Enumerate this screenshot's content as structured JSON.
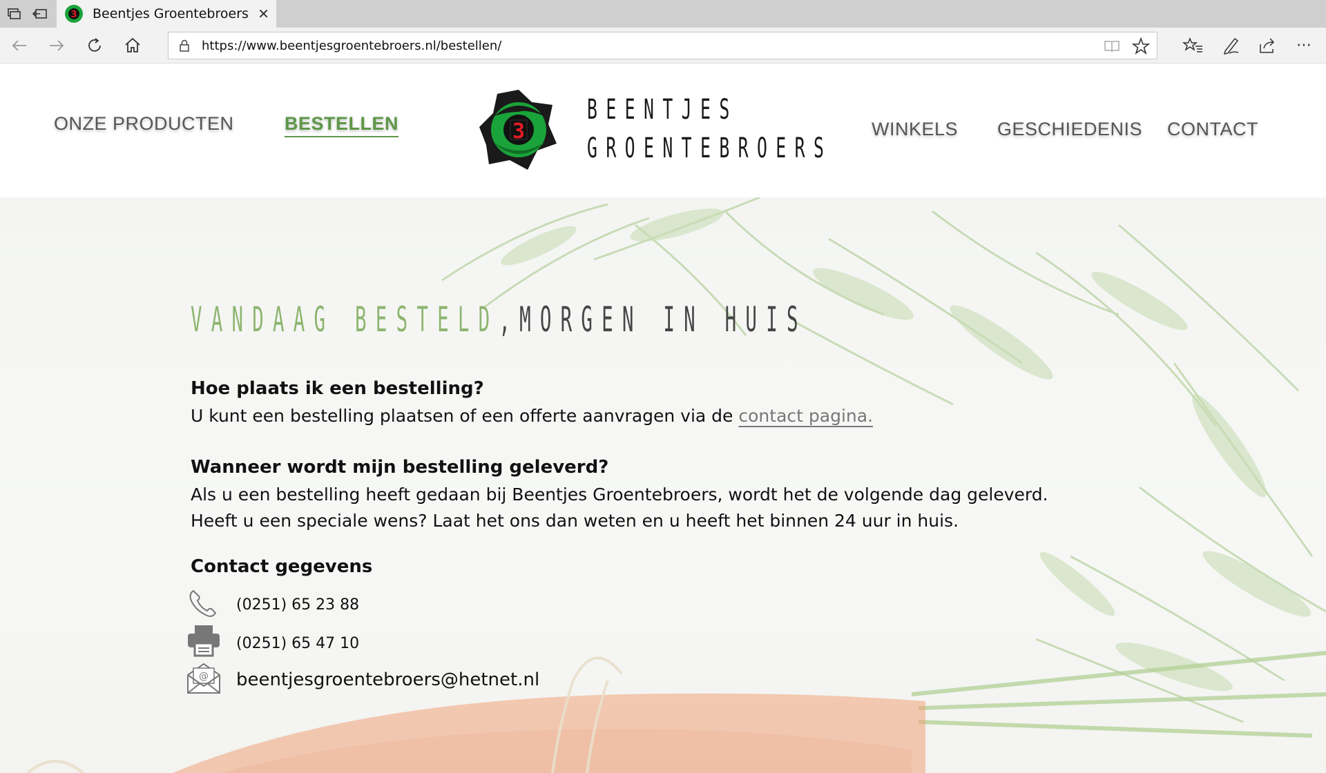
{
  "browser": {
    "tab_title": "Beentjes Groentebroers",
    "url": "https://www.beentjesgroentebroers.nl/bestellen/"
  },
  "icons": {
    "tab_actions": "tab-actions-icon",
    "set_aside": "set-aside-tabs-icon",
    "close": "close-icon",
    "back": "back-arrow-icon",
    "forward": "forward-arrow-icon",
    "refresh": "refresh-icon",
    "home": "home-icon",
    "lock": "lock-icon",
    "reading_view": "reading-view-icon",
    "favorite": "star-icon",
    "favorites": "favorites-list-icon",
    "notes": "pen-icon",
    "share": "share-icon",
    "more": "more-icon",
    "phone": "phone-icon",
    "fax": "printer-icon",
    "email": "email-icon"
  },
  "nav": {
    "products": "ONZE PRODUCTEN",
    "order": "BESTELLEN",
    "stores": "WINKELS",
    "history": "GESCHIEDENIS",
    "contact": "CONTACT"
  },
  "brand": {
    "line1": "BEENTJES",
    "line2": "GROENTEBROERS",
    "colors": {
      "green": "#5f9748",
      "logo_green": "#1aa33a",
      "logo_red": "#e21b24"
    }
  },
  "content": {
    "tagline_part1": "VANDAAG BESTELD",
    "tagline_sep": ",",
    "tagline_part2": "MORGEN IN HUIS",
    "q1": "Hoe plaats ik een bestelling?",
    "a1_text": "U kunt een bestelling plaatsen of een offerte aanvragen via de ",
    "a1_link": "contact pagina.",
    "q2": "Wanneer wordt mijn bestelling geleverd?",
    "a2_line1": "Als u een bestelling heeft gedaan bij Beentjes Groentebroers, wordt het de volgende dag geleverd.",
    "a2_line2": "Heeft u een speciale wens? Laat het ons dan weten en u heeft het binnen 24 uur in huis.",
    "contact_heading": "Contact gegevens",
    "phone": "(0251) 65 23 88",
    "fax": "(0251) 65 47 10",
    "email": "beentjesgroentebroers@hetnet.nl"
  }
}
